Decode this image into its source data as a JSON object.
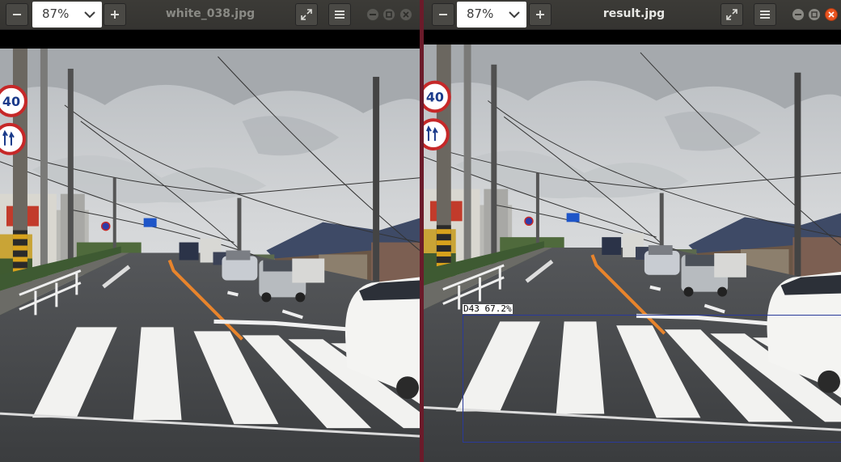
{
  "left_window": {
    "title": "white_038.jpg",
    "zoom": "87%",
    "icons": {
      "zoom_out": "minus-icon",
      "zoom_in": "plus-icon",
      "fullscreen": "fullscreen-icon",
      "menu": "hamburger-menu-icon",
      "minimize": "minimize-icon",
      "maximize": "maximize-icon",
      "close": "close-icon"
    }
  },
  "right_window": {
    "title": "result.jpg",
    "zoom": "87%",
    "detection_label": "D43 67.2%",
    "icons": {
      "zoom_out": "minus-icon",
      "zoom_in": "plus-icon",
      "fullscreen": "fullscreen-icon",
      "menu": "hamburger-menu-icon",
      "minimize": "minimize-icon",
      "maximize": "maximize-icon",
      "close": "close-icon"
    }
  },
  "photo_signs": {
    "speed_limit": "40"
  },
  "colors": {
    "titlebar": "#3c3b37",
    "title_inactive": "#8a8a85",
    "title_active": "#e8e8e5",
    "close_active": "#e95420",
    "divider": "#6b1b2a",
    "detection_box": "#2a3a9a",
    "road_line": "#e8842c"
  }
}
